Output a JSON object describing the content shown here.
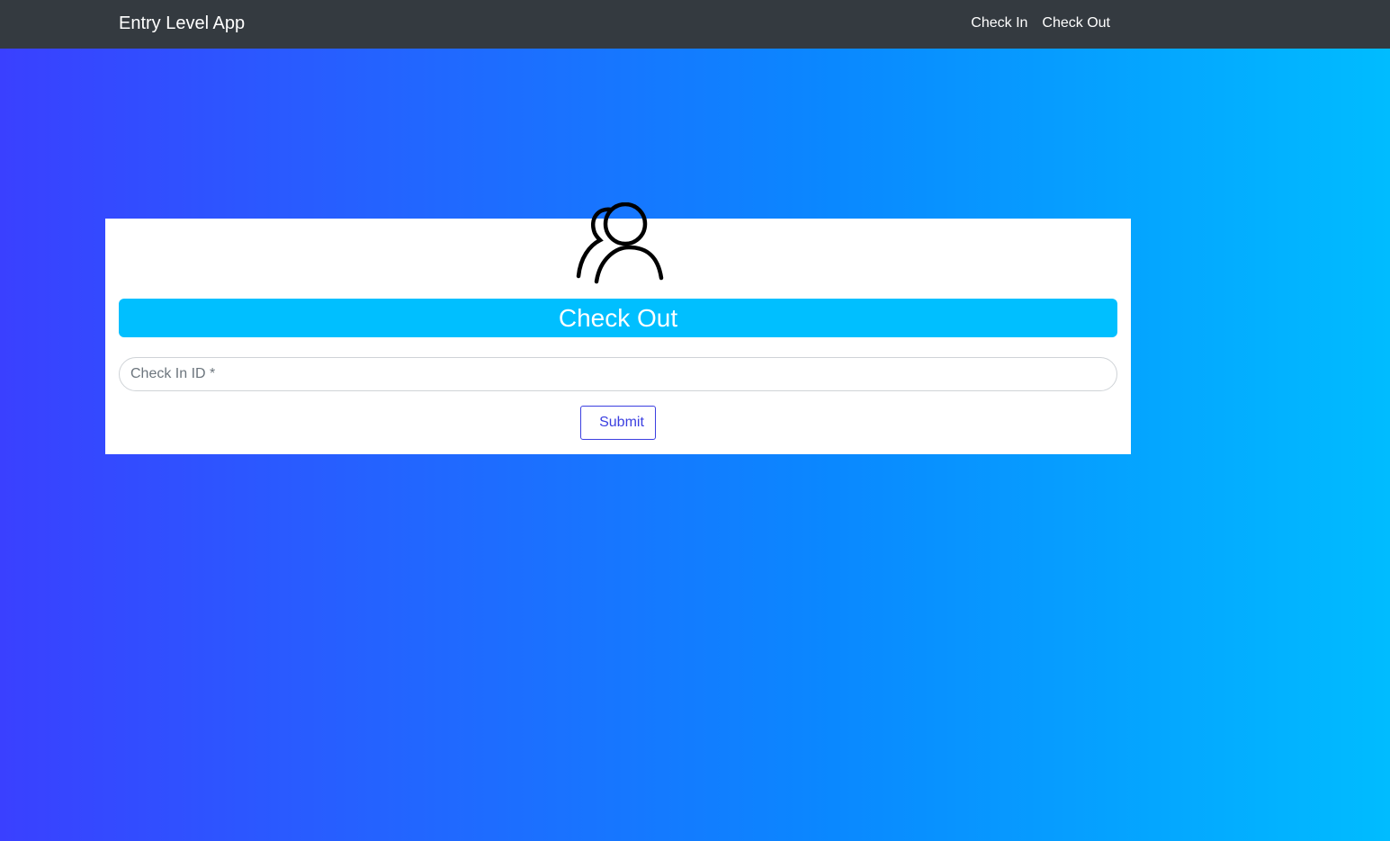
{
  "navbar": {
    "brand": "Entry Level App",
    "links": [
      {
        "label": "Check In"
      },
      {
        "label": "Check Out"
      }
    ],
    "background": "#343a40"
  },
  "form": {
    "icon": "users-icon",
    "title": "Check Out",
    "title_color": "#00bfff",
    "check_in_id": {
      "value": "",
      "placeholder": "Check In ID *"
    },
    "submit_label": "Submit",
    "submit_color": "#3b3fe0"
  },
  "background_gradient": [
    "#3a40ff",
    "#00bcff"
  ]
}
